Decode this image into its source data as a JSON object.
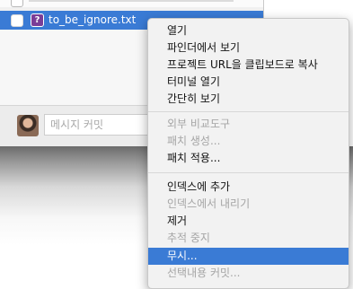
{
  "file_list": {
    "selected_item": {
      "status_icon": "question-mark-icon",
      "status_glyph": "?",
      "filename": "to_be_ignore.txt"
    }
  },
  "commit": {
    "placeholder": "메시지 커밋"
  },
  "context_menu": {
    "items": [
      {
        "label": "열기",
        "enabled": true
      },
      {
        "label": "파인더에서 보기",
        "enabled": true
      },
      {
        "label": "프로젝트 URL을 클립보드로 복사",
        "enabled": true
      },
      {
        "label": "터미널 열기",
        "enabled": true
      },
      {
        "label": "간단히 보기",
        "enabled": true
      },
      {
        "label": "외부 비교도구",
        "enabled": false
      },
      {
        "label": "패치 생성...",
        "enabled": false
      },
      {
        "label": "패치 적용...",
        "enabled": true
      },
      {
        "label": "인덱스에 추가",
        "enabled": true
      },
      {
        "label": "인덱스에서 내리기",
        "enabled": false
      },
      {
        "label": "제거",
        "enabled": true
      },
      {
        "label": "추적 중지",
        "enabled": false
      },
      {
        "label": "무시...",
        "enabled": true,
        "highlighted": true
      },
      {
        "label": "선택내용 커밋...",
        "enabled": false
      }
    ]
  },
  "colors": {
    "selection": "#3a7bd5",
    "menu_bg": "#f2f2f2",
    "disabled_text": "#a5a5a5"
  }
}
